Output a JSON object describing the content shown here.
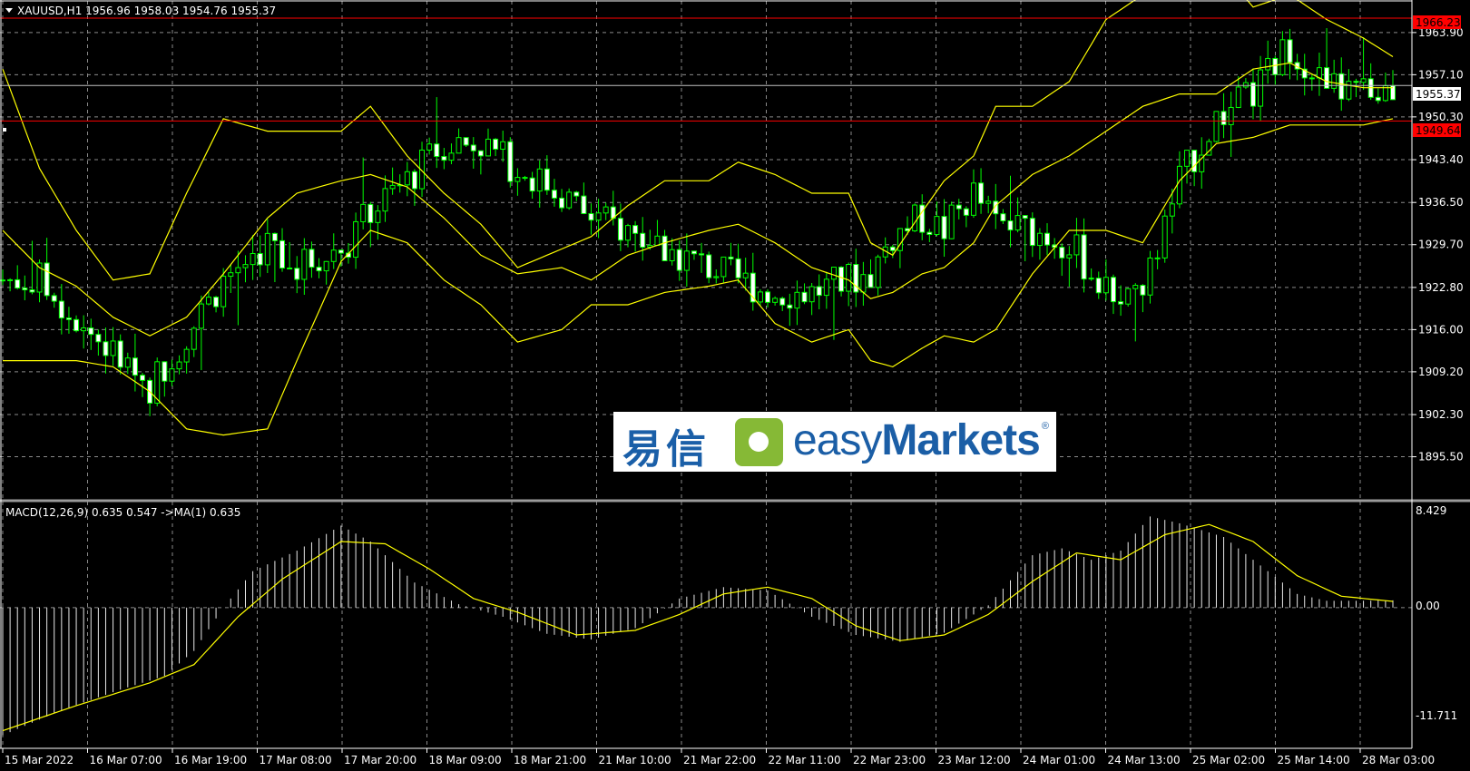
{
  "header": {
    "symbol_line": "XAUUSD,H1  1956.96 1958.03 1954.76 1955.37"
  },
  "macd": {
    "label": "MACD(12,26,9) 0.635 0.547  ->MA(1) 0.635",
    "scale_top": "8.429",
    "scale_zero": "0.00",
    "scale_bottom": "-11.711",
    "range": [
      -11.711,
      8.429
    ]
  },
  "price_axis": {
    "ticks": [
      "1963.90",
      "1957.10",
      "1950.30",
      "1943.40",
      "1936.50",
      "1929.70",
      "1922.80",
      "1916.00",
      "1909.20",
      "1902.30",
      "1895.50"
    ],
    "range": [
      1889.0,
      1969.0
    ]
  },
  "levels": {
    "resistance": {
      "value": 1966.23,
      "label": "1966.23",
      "color": "#ff0000"
    },
    "support": {
      "value": 1949.64,
      "label": "1949.64",
      "color": "#ff0000"
    },
    "current": {
      "value": 1955.37,
      "label": "1955.37",
      "color": "#c0c0c0"
    }
  },
  "time_axis": [
    "15 Mar 2022",
    "16 Mar 07:00",
    "16 Mar 19:00",
    "17 Mar 08:00",
    "17 Mar 20:00",
    "18 Mar 09:00",
    "18 Mar 21:00",
    "21 Mar 10:00",
    "21 Mar 22:00",
    "22 Mar 11:00",
    "22 Mar 23:00",
    "23 Mar 12:00",
    "24 Mar 01:00",
    "24 Mar 13:00",
    "25 Mar 02:00",
    "25 Mar 14:00",
    "28 Mar 03:00"
  ],
  "colors": {
    "background": "#000000",
    "grid": "#8a8a8a",
    "candle": "#00ff00",
    "bollinger": "#ffff00",
    "macd_hist": "#e8e8e8",
    "macd_signal": "#ffff00",
    "axis_text": "#ffffff"
  },
  "watermark": {
    "chinese": "易信",
    "english_prefix": "easy",
    "english_suffix": "Markets",
    "registered": "®"
  },
  "chart_data": {
    "type": "candlestick",
    "symbol": "XAUUSD",
    "timeframe": "H1",
    "ohlc_last": {
      "open": 1956.96,
      "high": 1958.03,
      "low": 1954.76,
      "close": 1955.37
    },
    "close_path": [
      [
        0,
        1924
      ],
      [
        5,
        1924
      ],
      [
        10,
        1918
      ],
      [
        15,
        1912
      ],
      [
        20,
        1907
      ],
      [
        25,
        1915
      ],
      [
        30,
        1924
      ],
      [
        36,
        1930
      ],
      [
        40,
        1926
      ],
      [
        46,
        1929
      ],
      [
        50,
        1935
      ],
      [
        55,
        1940
      ],
      [
        60,
        1946
      ],
      [
        65,
        1946
      ],
      [
        70,
        1942
      ],
      [
        76,
        1938
      ],
      [
        80,
        1934
      ],
      [
        85,
        1932
      ],
      [
        90,
        1929
      ],
      [
        96,
        1926
      ],
      [
        100,
        1924
      ],
      [
        105,
        1922
      ],
      [
        110,
        1922
      ],
      [
        115,
        1924
      ],
      [
        118,
        1925
      ],
      [
        121,
        1931
      ],
      [
        125,
        1934
      ],
      [
        128,
        1932
      ],
      [
        132,
        1938
      ],
      [
        135,
        1933
      ],
      [
        140,
        1932
      ],
      [
        145,
        1930
      ],
      [
        150,
        1922
      ],
      [
        155,
        1922
      ],
      [
        160,
        1940
      ],
      [
        165,
        1950
      ],
      [
        170,
        1954
      ],
      [
        175,
        1962
      ],
      [
        180,
        1955
      ],
      [
        185,
        1954
      ],
      [
        189,
        1955
      ]
    ],
    "bb_upper": [
      [
        0,
        1958
      ],
      [
        5,
        1942
      ],
      [
        10,
        1932
      ],
      [
        15,
        1924
      ],
      [
        20,
        1925
      ],
      [
        25,
        1938
      ],
      [
        30,
        1950
      ],
      [
        36,
        1948
      ],
      [
        40,
        1948
      ],
      [
        46,
        1948
      ],
      [
        50,
        1952
      ],
      [
        55,
        1944
      ],
      [
        60,
        1938
      ],
      [
        65,
        1933
      ],
      [
        70,
        1926
      ],
      [
        76,
        1929
      ],
      [
        80,
        1931
      ],
      [
        85,
        1936
      ],
      [
        90,
        1940
      ],
      [
        96,
        1940
      ],
      [
        100,
        1943
      ],
      [
        105,
        1941
      ],
      [
        110,
        1938
      ],
      [
        115,
        1938
      ],
      [
        118,
        1930
      ],
      [
        121,
        1928
      ],
      [
        125,
        1935
      ],
      [
        128,
        1940
      ],
      [
        132,
        1944
      ],
      [
        135,
        1952
      ],
      [
        140,
        1952
      ],
      [
        145,
        1956
      ],
      [
        150,
        1966
      ],
      [
        155,
        1970
      ],
      [
        160,
        1970
      ],
      [
        165,
        1975
      ],
      [
        170,
        1968
      ],
      [
        175,
        1970
      ],
      [
        180,
        1966
      ],
      [
        185,
        1963
      ],
      [
        189,
        1960
      ]
    ],
    "bb_mid": [
      [
        0,
        1932
      ],
      [
        5,
        1926
      ],
      [
        10,
        1923
      ],
      [
        15,
        1918
      ],
      [
        20,
        1915
      ],
      [
        25,
        1918
      ],
      [
        30,
        1925
      ],
      [
        36,
        1934
      ],
      [
        40,
        1938
      ],
      [
        46,
        1940
      ],
      [
        50,
        1941
      ],
      [
        55,
        1939
      ],
      [
        60,
        1934
      ],
      [
        65,
        1928
      ],
      [
        70,
        1925
      ],
      [
        76,
        1926
      ],
      [
        80,
        1924
      ],
      [
        85,
        1928
      ],
      [
        90,
        1930
      ],
      [
        96,
        1932
      ],
      [
        100,
        1933
      ],
      [
        105,
        1930
      ],
      [
        110,
        1926
      ],
      [
        115,
        1924
      ],
      [
        118,
        1921
      ],
      [
        121,
        1922
      ],
      [
        125,
        1925
      ],
      [
        128,
        1926
      ],
      [
        132,
        1930
      ],
      [
        135,
        1936
      ],
      [
        140,
        1941
      ],
      [
        145,
        1944
      ],
      [
        150,
        1948
      ],
      [
        155,
        1952
      ],
      [
        160,
        1954
      ],
      [
        165,
        1954
      ],
      [
        170,
        1958
      ],
      [
        175,
        1959
      ],
      [
        180,
        1956
      ],
      [
        185,
        1955
      ],
      [
        189,
        1955
      ]
    ],
    "bb_lower": [
      [
        0,
        1911
      ],
      [
        5,
        1911
      ],
      [
        10,
        1911
      ],
      [
        15,
        1910
      ],
      [
        20,
        1906
      ],
      [
        25,
        1900
      ],
      [
        30,
        1899
      ],
      [
        36,
        1900
      ],
      [
        40,
        1911
      ],
      [
        46,
        1927
      ],
      [
        50,
        1932
      ],
      [
        55,
        1930
      ],
      [
        60,
        1924
      ],
      [
        65,
        1920
      ],
      [
        70,
        1914
      ],
      [
        76,
        1916
      ],
      [
        80,
        1920
      ],
      [
        85,
        1920
      ],
      [
        90,
        1922
      ],
      [
        96,
        1923
      ],
      [
        100,
        1924
      ],
      [
        105,
        1917
      ],
      [
        110,
        1914
      ],
      [
        115,
        1916
      ],
      [
        118,
        1911
      ],
      [
        121,
        1910
      ],
      [
        125,
        1913
      ],
      [
        128,
        1915
      ],
      [
        132,
        1914
      ],
      [
        135,
        1916
      ],
      [
        140,
        1925
      ],
      [
        145,
        1932
      ],
      [
        150,
        1932
      ],
      [
        155,
        1930
      ],
      [
        160,
        1940
      ],
      [
        165,
        1946
      ],
      [
        170,
        1947
      ],
      [
        175,
        1949
      ],
      [
        180,
        1949
      ],
      [
        185,
        1949
      ],
      [
        189,
        1950
      ]
    ],
    "macd_path": [
      [
        0,
        -11.2
      ],
      [
        8,
        -9.0
      ],
      [
        16,
        -7.2
      ],
      [
        22,
        -6.0
      ],
      [
        26,
        -3.8
      ],
      [
        30,
        0
      ],
      [
        34,
        3.2
      ],
      [
        40,
        5.0
      ],
      [
        46,
        7.2
      ],
      [
        50,
        5.8
      ],
      [
        56,
        2.2
      ],
      [
        62,
        0.3
      ],
      [
        68,
        -0.8
      ],
      [
        74,
        -2.3
      ],
      [
        80,
        -2.8
      ],
      [
        86,
        -1.8
      ],
      [
        92,
        0.8
      ],
      [
        98,
        1.8
      ],
      [
        104,
        1.5
      ],
      [
        110,
        -0.8
      ],
      [
        116,
        -2.4
      ],
      [
        122,
        -3.0
      ],
      [
        128,
        -2.2
      ],
      [
        134,
        0.2
      ],
      [
        140,
        4.6
      ],
      [
        144,
        5.2
      ],
      [
        148,
        4.2
      ],
      [
        152,
        5.0
      ],
      [
        156,
        8.0
      ],
      [
        160,
        7.4
      ],
      [
        166,
        6.2
      ],
      [
        172,
        3.2
      ],
      [
        176,
        1.2
      ],
      [
        180,
        0.6
      ],
      [
        184,
        0.6
      ],
      [
        189,
        0.635
      ]
    ],
    "signal_path": [
      [
        0,
        -10.8
      ],
      [
        10,
        -8.6
      ],
      [
        20,
        -6.6
      ],
      [
        26,
        -5.0
      ],
      [
        32,
        -0.8
      ],
      [
        38,
        2.5
      ],
      [
        46,
        5.8
      ],
      [
        52,
        5.6
      ],
      [
        58,
        3.4
      ],
      [
        64,
        0.8
      ],
      [
        70,
        -0.4
      ],
      [
        78,
        -2.4
      ],
      [
        86,
        -2.0
      ],
      [
        92,
        -0.6
      ],
      [
        98,
        1.2
      ],
      [
        104,
        1.8
      ],
      [
        110,
        0.8
      ],
      [
        116,
        -1.6
      ],
      [
        122,
        -2.9
      ],
      [
        128,
        -2.4
      ],
      [
        134,
        -0.6
      ],
      [
        140,
        2.3
      ],
      [
        146,
        4.8
      ],
      [
        152,
        4.2
      ],
      [
        158,
        6.4
      ],
      [
        164,
        7.3
      ],
      [
        170,
        5.8
      ],
      [
        176,
        2.8
      ],
      [
        182,
        1.0
      ],
      [
        189,
        0.547
      ]
    ],
    "bars_count": 190,
    "price_range": [
      1889.0,
      1969.0
    ],
    "macd_range": [
      -11.711,
      8.429
    ]
  }
}
